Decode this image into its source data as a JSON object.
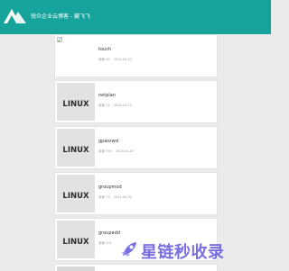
{
  "site": {
    "title": "锐众企业云博客 - 藏飞飞"
  },
  "posts": [
    {
      "title": "touch",
      "views_label": "阅读 40",
      "date": "2024-04-22",
      "thumb": "broken-image"
    },
    {
      "title": "netplan",
      "views_label": "阅读 14",
      "date": "2024-04-12",
      "thumb": "linux-logo"
    },
    {
      "title": "gpasswd",
      "views_label": "阅读 395",
      "date": "2024-04-07",
      "thumb": "linux-logo"
    },
    {
      "title": "groupmod",
      "views_label": "阅读 77",
      "date": "2024-04-02",
      "thumb": "linux-logo"
    },
    {
      "title": "groupadd",
      "views_label": "阅读 101",
      "date": "",
      "thumb": "linux-logo"
    }
  ],
  "thumb_text": "LINUX",
  "watermark": {
    "text": "星链秒收录",
    "color": "#7a6fe0"
  }
}
